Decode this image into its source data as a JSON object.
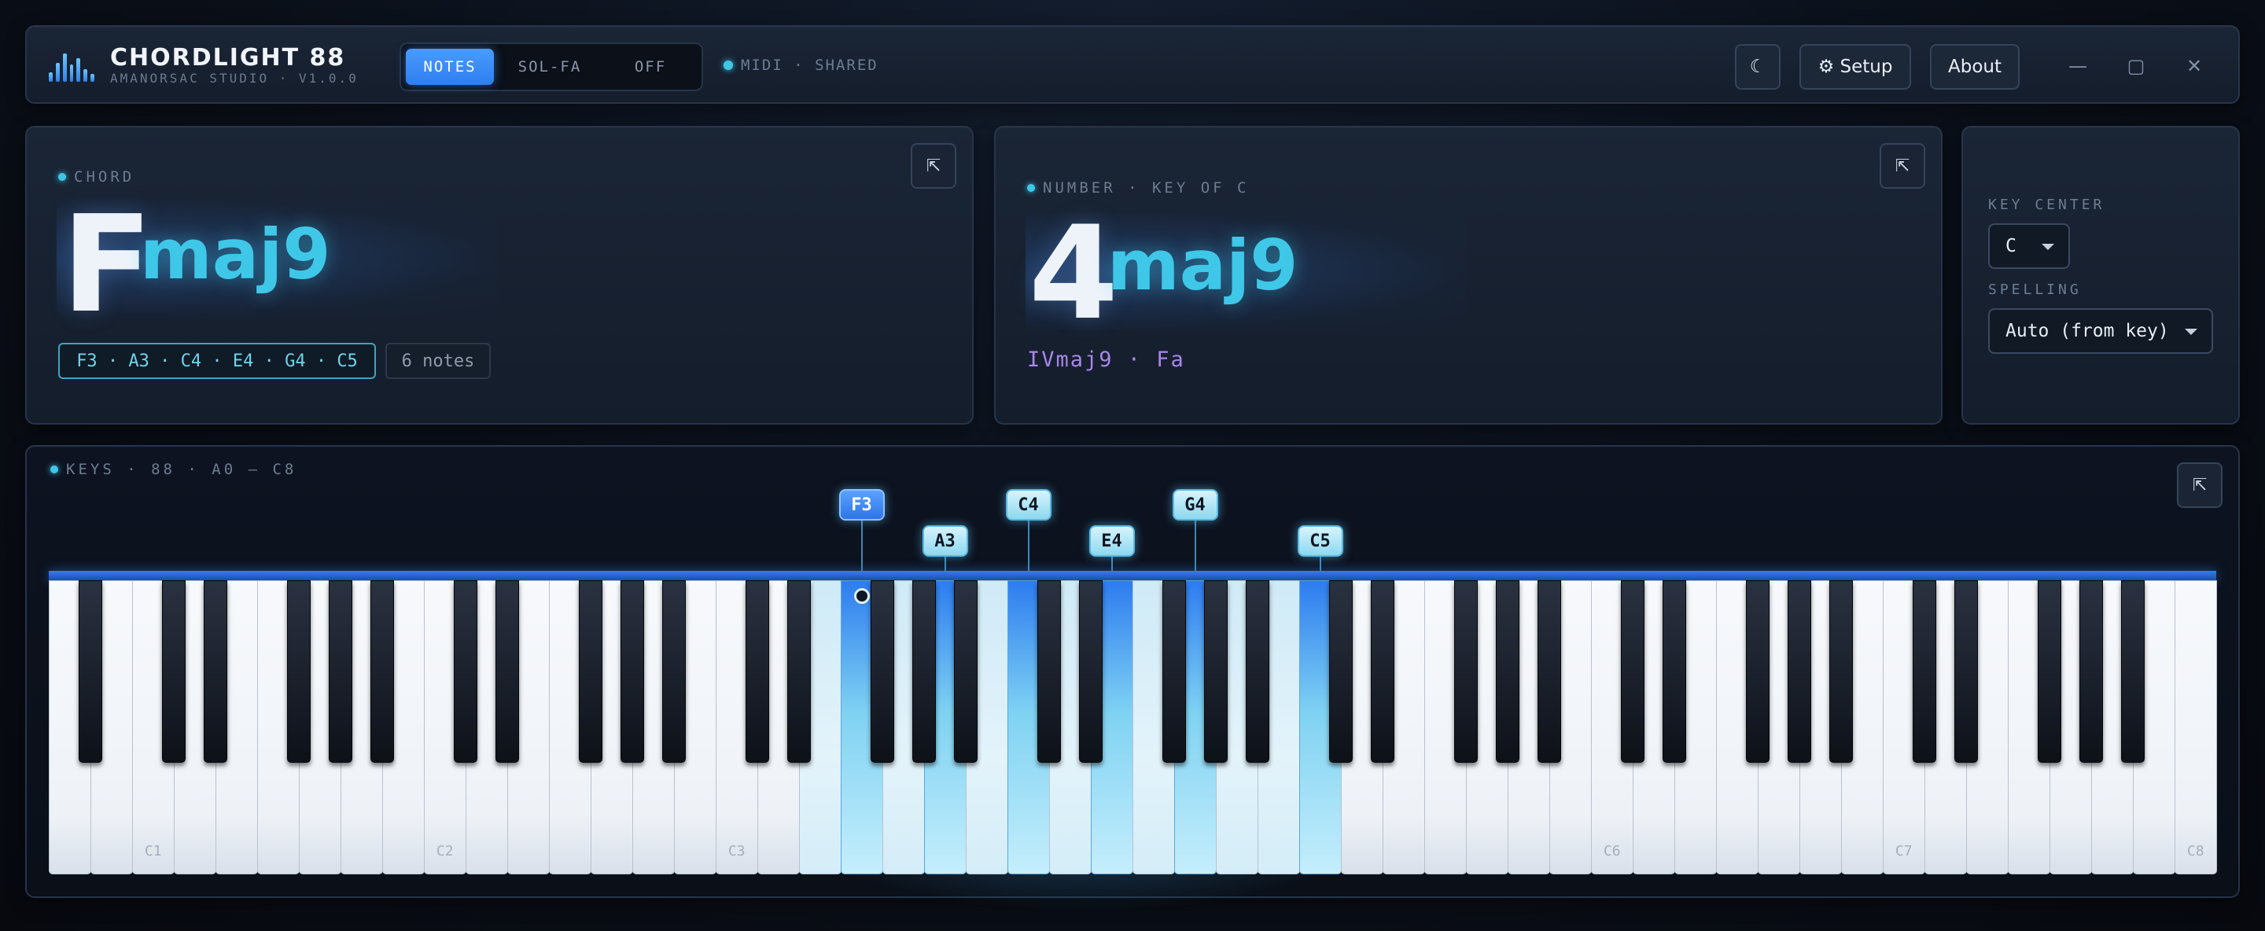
{
  "app": {
    "title": "CHORDLIGHT 88",
    "subtitle": "AMANORSAC STUDIO · V1.0.0"
  },
  "mode_toggle": {
    "options": [
      "NOTES",
      "SOL-FA",
      "OFF"
    ],
    "selected": "NOTES"
  },
  "midi_status": "MIDI · SHARED",
  "toolbar": {
    "theme_icon": "☾",
    "setup_label": "⚙ Setup",
    "about_label": "About"
  },
  "window_controls": {
    "minimize": "—",
    "maximize": "▢",
    "close": "✕"
  },
  "chord_panel": {
    "label": "CHORD",
    "root": "F",
    "quality": "maj9",
    "notes_text": "F3 · A3 · C4 · E4 · G4 · C5",
    "notes_count": "6 notes",
    "expand_icon": "⇱"
  },
  "number_panel": {
    "label": "NUMBER · KEY OF C",
    "degree": "4",
    "quality": "maj9",
    "roman": "IVmaj9 · Fa",
    "expand_icon": "⇱"
  },
  "key_panel": {
    "key_center_label": "KEY CENTER",
    "key_center_value": "C",
    "spelling_label": "SPELLING",
    "spelling_value": "Auto (from key)"
  },
  "keys_panel": {
    "label": "KEYS · 88 · A0 — C8",
    "expand_icon": "⇱",
    "octave_labels": [
      "C1",
      "C2",
      "C3",
      "C6",
      "C7",
      "C8"
    ],
    "active_notes": [
      "F3",
      "A3",
      "C4",
      "E4",
      "G4",
      "C5"
    ],
    "root_note": "F3"
  },
  "colors": {
    "accent": "#3fc7e8",
    "primary": "#2e7ef0",
    "roman": "#a886e8"
  }
}
